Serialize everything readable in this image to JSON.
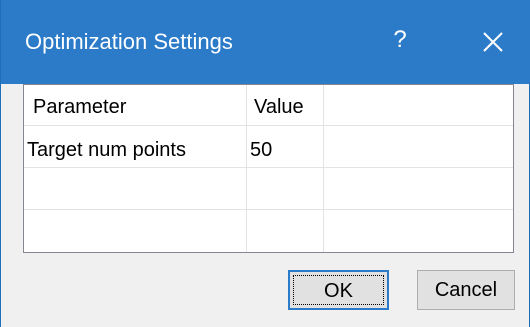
{
  "dialog": {
    "title": "Optimization Settings",
    "help_glyph": "?",
    "close_icon": "close-icon"
  },
  "table": {
    "columns": [
      "Parameter",
      "Value"
    ],
    "rows": [
      [
        "Target num points",
        "50"
      ],
      [
        "",
        ""
      ],
      [
        "",
        ""
      ]
    ]
  },
  "buttons": {
    "ok_label": "OK",
    "cancel_label": "Cancel"
  },
  "colors": {
    "titlebar": "#2b7bc9",
    "window_bg": "#f0f0f0",
    "focus_border": "#2b7bc9"
  }
}
